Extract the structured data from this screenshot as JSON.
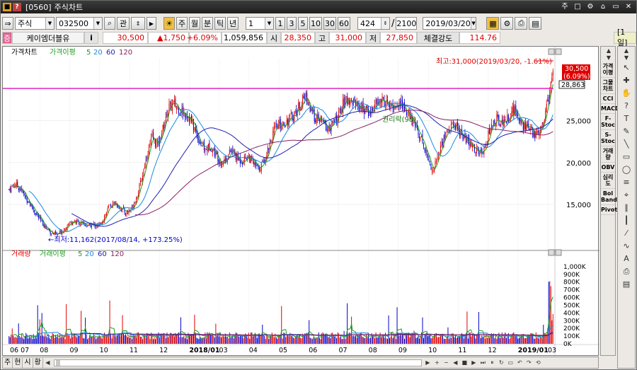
{
  "window": {
    "screen_no": "[0560]",
    "title": "주식차트",
    "win_buttons": [
      "주",
      "□",
      "⚙",
      "⌂",
      "▭",
      "✕"
    ]
  },
  "toolbar": {
    "market": "주식",
    "code": "032500",
    "search_icon": "magnifier-icon",
    "gwan_label": "관",
    "periods": [
      "주",
      "월",
      "분",
      "틱",
      "년"
    ],
    "interval_value": "1",
    "minute_buttons": [
      "1",
      "3",
      "5",
      "10",
      "30",
      "60"
    ],
    "count_value": "424",
    "total_value": "2100",
    "date_value": "2019/03/20"
  },
  "quote": {
    "flag": "증",
    "name": "케이엠더블유",
    "info": "i",
    "price": "30,500",
    "change": "▲1,750",
    "change_pct": "+6.09%",
    "volume": "1,059,856",
    "open_label": "시",
    "open": "28,350",
    "high_label": "고",
    "high": "31,000",
    "low_label": "저",
    "low": "27,850",
    "strength_label": "체결강도",
    "strength": "114.76",
    "period_tag": "[1일]"
  },
  "price_chart": {
    "legend_main": "가격차트",
    "legend_ma": "가격이평",
    "ma_periods": [
      {
        "label": "5",
        "color": "#1aa01a"
      },
      {
        "label": "20",
        "color": "#1a8ae0"
      },
      {
        "label": "60",
        "color": "#2020b0"
      },
      {
        "label": "120",
        "color": "#8a2060"
      }
    ],
    "annotations": {
      "high": "최고:31,000(2019/03/20, -1.61%)",
      "low": "←최저:11,162(2017/08/14, +173.25%)",
      "rights": "권리락(98)"
    },
    "last_price_tag": "30,500",
    "last_pct_tag": "(6.09%)",
    "cursor_tag": "28,863"
  },
  "volume_chart": {
    "legend_main": "거래량",
    "legend_ma": "거래이평",
    "ma_periods": [
      {
        "label": "5",
        "color": "#1aa01a"
      },
      {
        "label": "20",
        "color": "#1a8ae0"
      },
      {
        "label": "60",
        "color": "#2020b0"
      },
      {
        "label": "120",
        "color": "#8a2060"
      }
    ]
  },
  "chart_data": {
    "type": "candlestick",
    "price_axis_ticks": [
      "25,000",
      "20,000",
      "15,000"
    ],
    "price_axis_values": [
      25000,
      20000,
      15000
    ],
    "price_range": [
      10000,
      32500
    ],
    "volume_axis_ticks": [
      "1,000K",
      "900K",
      "800K",
      "700K",
      "600K",
      "500K",
      "400K",
      "300K",
      "200K",
      "100K",
      "0K"
    ],
    "volume_range": [
      0,
      1100000
    ],
    "x_ticks": [
      "06 07",
      "08",
      "09",
      "10",
      "11",
      "12",
      "2018/01",
      "03",
      "04",
      "05",
      "06",
      "07",
      "08",
      "09",
      "10",
      "11",
      "12",
      "2019/01",
      "03"
    ],
    "series": [
      {
        "name": "5",
        "color": "#1aa01a"
      },
      {
        "name": "20",
        "color": "#1a8ae0"
      },
      {
        "name": "60",
        "color": "#2020b0"
      },
      {
        "name": "120",
        "color": "#8a2060"
      }
    ],
    "price_path": [
      [
        0,
        16800
      ],
      [
        5,
        17400
      ],
      [
        10,
        17000
      ],
      [
        15,
        16000
      ],
      [
        20,
        15000
      ],
      [
        25,
        14000
      ],
      [
        30,
        13000
      ],
      [
        35,
        12200
      ],
      [
        40,
        11600
      ],
      [
        45,
        11300
      ],
      [
        50,
        11800
      ],
      [
        55,
        12600
      ],
      [
        60,
        13000
      ],
      [
        65,
        12900
      ],
      [
        70,
        12600
      ],
      [
        75,
        12400
      ],
      [
        80,
        12600
      ],
      [
        85,
        12400
      ],
      [
        90,
        13600
      ],
      [
        95,
        14800
      ],
      [
        100,
        15200
      ],
      [
        105,
        14600
      ],
      [
        110,
        14000
      ],
      [
        115,
        14400
      ],
      [
        120,
        15800
      ],
      [
        125,
        18000
      ],
      [
        130,
        21000
      ],
      [
        135,
        23000
      ],
      [
        140,
        22000
      ],
      [
        145,
        24000
      ],
      [
        150,
        26500
      ],
      [
        155,
        27000
      ],
      [
        160,
        26500
      ],
      [
        165,
        26000
      ],
      [
        170,
        25500
      ],
      [
        175,
        24000
      ],
      [
        180,
        22500
      ],
      [
        185,
        21500
      ],
      [
        190,
        22000
      ],
      [
        195,
        21000
      ],
      [
        200,
        20000
      ],
      [
        205,
        20500
      ],
      [
        210,
        21500
      ],
      [
        215,
        20500
      ],
      [
        220,
        20200
      ],
      [
        225,
        20800
      ],
      [
        230,
        20000
      ],
      [
        235,
        19200
      ],
      [
        240,
        20000
      ],
      [
        245,
        22000
      ],
      [
        250,
        23800
      ],
      [
        255,
        24500
      ],
      [
        260,
        24800
      ],
      [
        265,
        25200
      ],
      [
        270,
        26000
      ],
      [
        275,
        27000
      ],
      [
        280,
        28000
      ],
      [
        285,
        26000
      ],
      [
        290,
        25200
      ],
      [
        295,
        25000
      ],
      [
        300,
        24000
      ],
      [
        305,
        24500
      ],
      [
        310,
        25300
      ],
      [
        315,
        27000
      ],
      [
        320,
        27600
      ],
      [
        325,
        27300
      ],
      [
        330,
        26800
      ],
      [
        335,
        26400
      ],
      [
        340,
        25900
      ],
      [
        345,
        26800
      ],
      [
        350,
        27400
      ],
      [
        355,
        27300
      ],
      [
        360,
        26500
      ],
      [
        365,
        26900
      ],
      [
        370,
        27100
      ],
      [
        375,
        26000
      ],
      [
        380,
        25000
      ],
      [
        385,
        24000
      ],
      [
        390,
        22500
      ],
      [
        395,
        20500
      ],
      [
        400,
        19000
      ],
      [
        405,
        21000
      ],
      [
        410,
        23000
      ],
      [
        415,
        24000
      ],
      [
        420,
        24600
      ],
      [
        425,
        23800
      ],
      [
        430,
        22800
      ],
      [
        435,
        22000
      ],
      [
        440,
        21600
      ],
      [
        445,
        21000
      ],
      [
        450,
        22500
      ],
      [
        455,
        24500
      ],
      [
        460,
        25200
      ],
      [
        465,
        24800
      ],
      [
        470,
        25300
      ],
      [
        475,
        26200
      ],
      [
        480,
        25800
      ],
      [
        485,
        24500
      ],
      [
        490,
        24000
      ],
      [
        495,
        23300
      ],
      [
        500,
        23800
      ],
      [
        505,
        25500
      ],
      [
        510,
        28500
      ],
      [
        513,
        30500
      ]
    ]
  },
  "side_indicators": [
    "가격이평",
    "그물차트",
    "CCI",
    "MACD",
    "F-Stoc",
    "S-Stoc",
    "거래량",
    "OBV",
    "심리도",
    "Bol Band",
    "Pivot"
  ],
  "side_tools": [
    "cursor-icon",
    "crosshair-icon",
    "hand-icon",
    "question-icon",
    "text-icon",
    "pen-icon",
    "line-icon",
    "rectangle-icon",
    "ellipse-icon",
    "fibo-icon",
    "gann-icon",
    "channel-icon",
    "candle-icon",
    "trend-icon",
    "wave-icon",
    "auto-icon",
    "print-icon",
    "save-icon"
  ],
  "bottom": {
    "tabs": [
      "주",
      "현",
      "시",
      "황"
    ]
  }
}
